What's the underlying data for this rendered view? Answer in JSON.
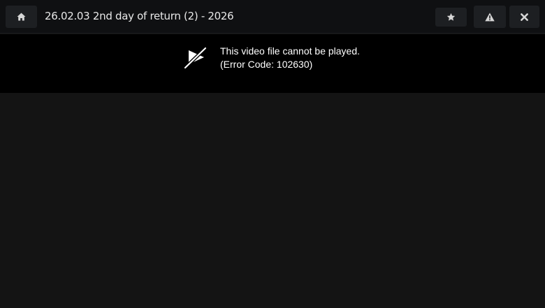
{
  "header": {
    "title": "26.02.03 2nd day of return (2) - 2026",
    "buttons": {
      "home_icon": "home-icon",
      "favorite_icon": "star-icon",
      "report_icon": "warning-icon",
      "close_icon": "close-icon"
    }
  },
  "player": {
    "error_icon": "video-off-icon",
    "error_line1": "This video file cannot be played.",
    "error_line2": "(Error Code: 102630)"
  },
  "colors": {
    "topbar_bg": "#0f1012",
    "button_bg": "#1d1f22",
    "player_bg": "#000000",
    "page_bg": "#141414",
    "text": "#ffffff"
  }
}
